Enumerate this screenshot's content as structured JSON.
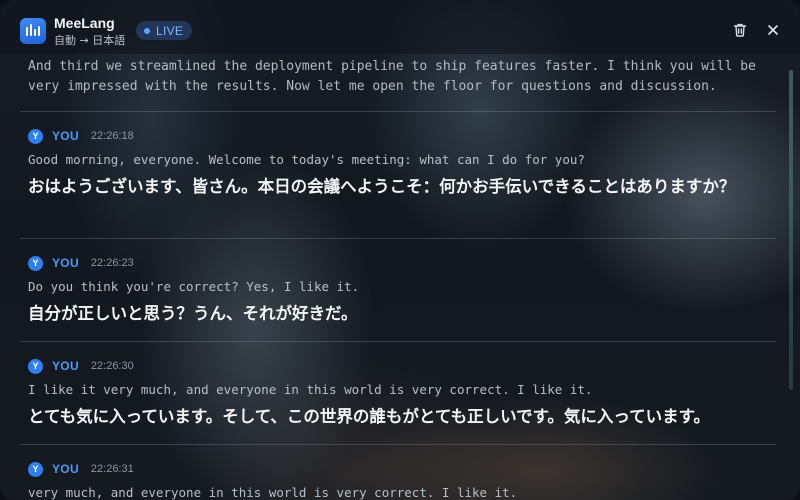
{
  "app": {
    "name": "MeeLang",
    "lang_route": "自動 → 日本語",
    "status_badge": "LIVE",
    "accent_color": "#3b82f6"
  },
  "toolbar": {
    "clear_icon": "trash-icon",
    "close_icon": "close-icon"
  },
  "transcript": {
    "previous_text": "And third we streamlined the deployment pipeline to ship features faster. I think you will be very impressed with the results. Now let me open the floor for questions and discussion.",
    "entries": [
      {
        "avatar": "Y",
        "speaker": "YOU",
        "time": "22:26:18",
        "source": "Good morning, everyone. Welcome to today's meeting: what can I do for you?",
        "translation": "おはようございます、皆さん。本日の会議へようこそ：何かお手伝いできることはありますか？"
      },
      {
        "avatar": "Y",
        "speaker": "YOU",
        "time": "22:26:23",
        "source": "Do you think you're correct? Yes, I like it.",
        "translation": "自分が正しいと思う？うん、それが好きだ。"
      },
      {
        "avatar": "Y",
        "speaker": "YOU",
        "time": "22:26:30",
        "source": "I like it very much, and everyone in this world is very correct. I like it.",
        "translation": "とても気に入っています。そして、この世界の誰もがとても正しいです。気に入っています。"
      },
      {
        "avatar": "Y",
        "speaker": "YOU",
        "time": "22:26:31",
        "source": "very much, and everyone in this world is very correct. I like it."
      }
    ]
  }
}
